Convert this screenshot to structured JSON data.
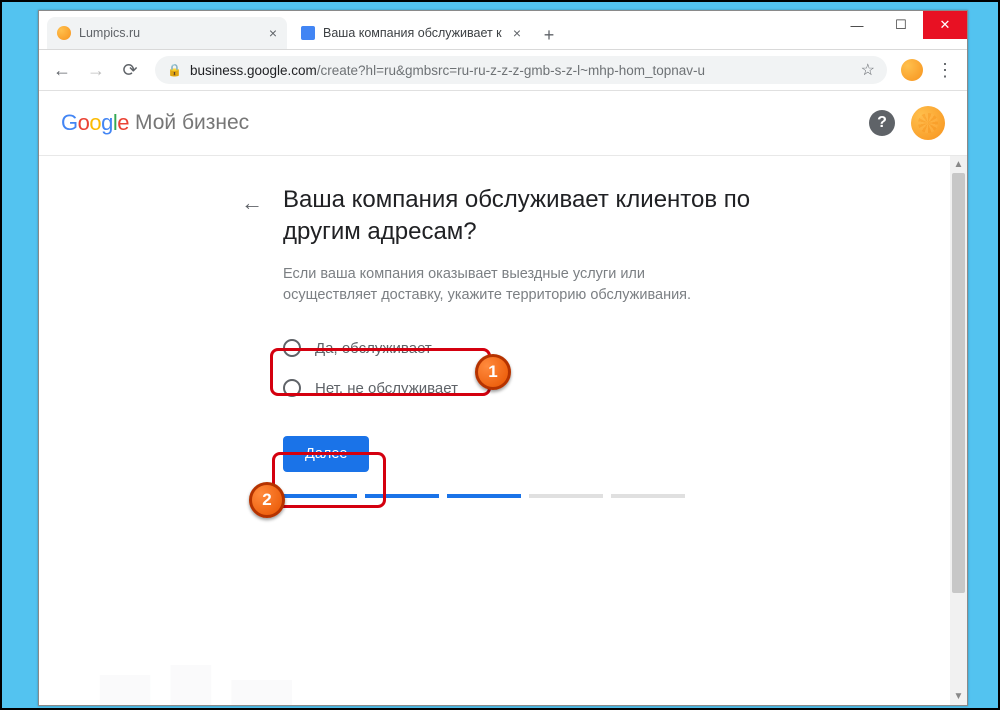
{
  "window_controls": {
    "min": "—",
    "max": "☐",
    "close": "✕"
  },
  "tabs": [
    {
      "title": "Lumpics.ru",
      "favicon": "orange",
      "active": false
    },
    {
      "title": "Ваша компания обслуживает к",
      "favicon": "blue",
      "active": true
    }
  ],
  "toolbar": {
    "url_root": "business.google.com",
    "url_rest": "/create?hl=ru&gmbsrc=ru-ru-z-z-z-gmb-s-z-l~mhp-hom_topnav-u"
  },
  "page_header": {
    "google": {
      "g1": "G",
      "g2": "o",
      "g3": "o",
      "g4": "g",
      "g5": "l",
      "g6": "e"
    },
    "product": "Мой бизнес",
    "help": "?"
  },
  "form": {
    "heading": "Ваша компания обслуживает клиентов по другим адресам?",
    "description": "Если ваша компания оказывает выездные услуги или осуществляет доставку, укажите территорию обслуживания.",
    "options": {
      "yes": "Да, обслуживает",
      "no": "Нет, не обслуживает"
    },
    "next": "Далее"
  },
  "progress": {
    "filled": 3,
    "total": 5
  },
  "annotations": {
    "b1": "1",
    "b2": "2"
  }
}
